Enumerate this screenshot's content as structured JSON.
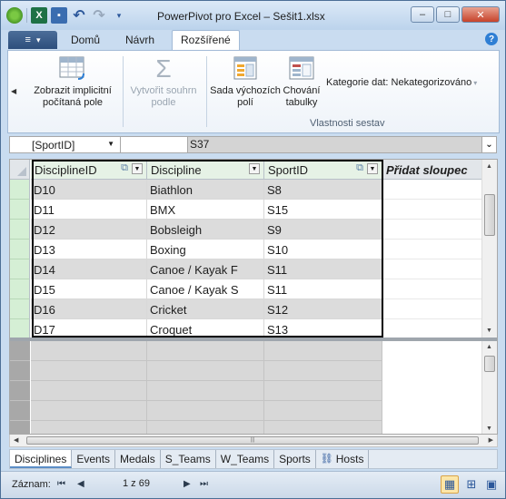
{
  "window": {
    "title": "PowerPivot pro Excel – Sešit1.xlsx",
    "controls": [
      "–",
      "□",
      "✕"
    ]
  },
  "quick_access": {
    "icons": [
      "powerpivot-icon",
      "excel-icon",
      "save-icon",
      "undo-icon",
      "redo-icon",
      "customize-icon"
    ]
  },
  "tabs": {
    "file_icon": "≡",
    "file_arrow": "▾",
    "items": [
      "Domů",
      "Návrh",
      "Rozšířené"
    ],
    "active": "Rozšířené",
    "help": "?"
  },
  "ribbon": {
    "implicit_fields": "Zobrazit implicitní počítaná pole",
    "create_summary": "Vytvořit souhrn podle",
    "default_fields": "Sada výchozích polí",
    "table_behavior": "Chování tabulky",
    "data_category": "Kategorie dat: Nekategorizováno",
    "group_label": "Vlastnosti sestav",
    "sigma": "Σ"
  },
  "formula_bar": {
    "name_box": "[SportID]",
    "formula": "S37"
  },
  "grid": {
    "columns": [
      "DisciplineID",
      "Discipline",
      "SportID"
    ],
    "add_column": "Přidat sloupec",
    "rows": [
      [
        "D10",
        "Biathlon",
        "S8"
      ],
      [
        "D11",
        "BMX",
        "S15"
      ],
      [
        "D12",
        "Bobsleigh",
        "S9"
      ],
      [
        "D13",
        "Boxing",
        "S10"
      ],
      [
        "D14",
        "Canoe / Kayak F",
        "S11"
      ],
      [
        "D15",
        "Canoe / Kayak S",
        "S11"
      ],
      [
        "D16",
        "Cricket",
        "S12"
      ],
      [
        "D17",
        "Croquet",
        "S13"
      ]
    ]
  },
  "sheets": {
    "items": [
      "Disciplines",
      "Events",
      "Medals",
      "S_Teams",
      "W_Teams",
      "Sports",
      "Hosts"
    ],
    "active": "Disciplines"
  },
  "status": {
    "record_label": "Záznam:",
    "record_position": "1 z 69",
    "nav_first": "⏮",
    "nav_prev": "◀",
    "nav_next": "▶",
    "nav_last": "⏭"
  }
}
